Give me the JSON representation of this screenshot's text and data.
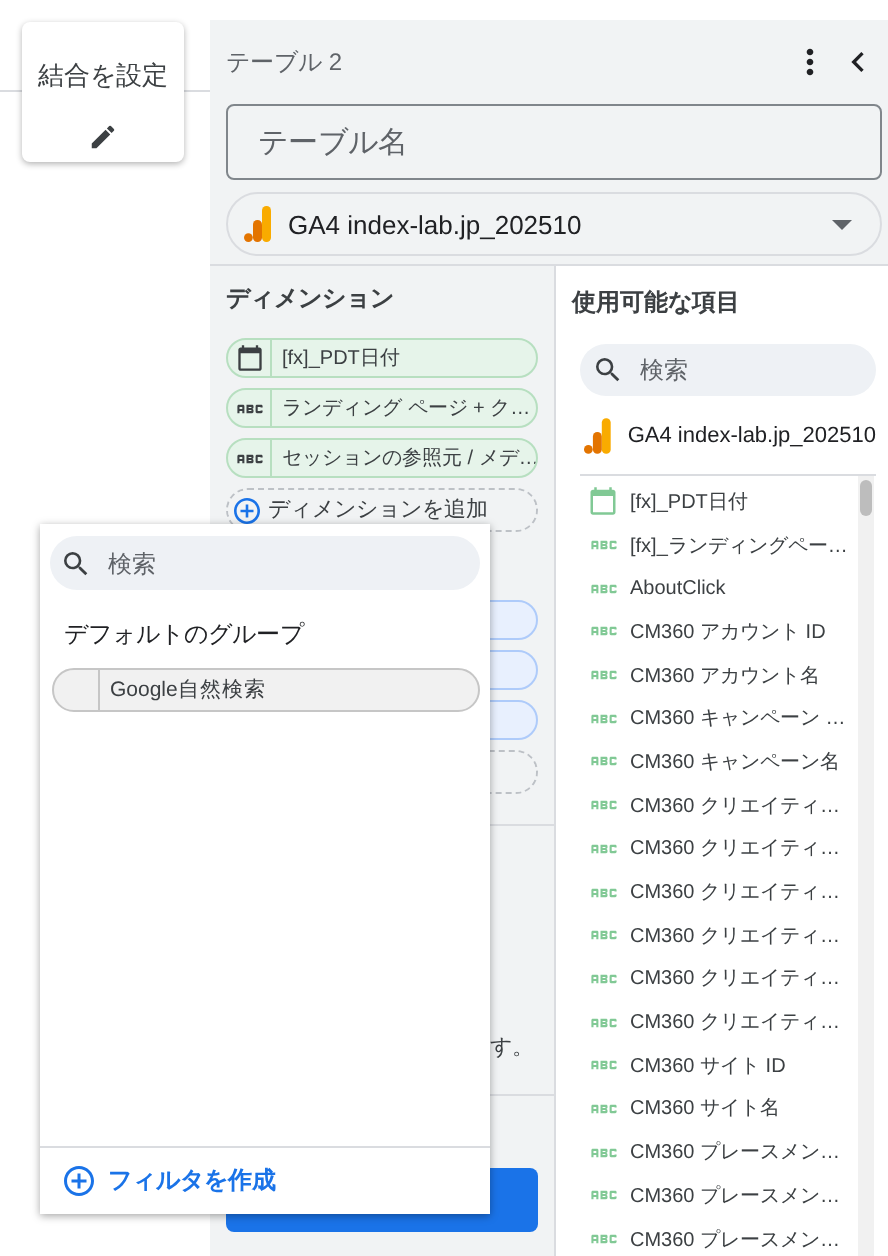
{
  "join_card": {
    "label": "結合を設定"
  },
  "panel": {
    "title": "テーブル 2",
    "name_field": {
      "placeholder": "テーブル名"
    },
    "source": "GA4 index-lab.jp_202510"
  },
  "dimensions": {
    "heading": "ディメンション",
    "items": [
      {
        "kind": "date",
        "label": "[fx]_PDT日付"
      },
      {
        "kind": "text",
        "label": "ランディング ページ + ク…"
      },
      {
        "kind": "text",
        "label": "セッションの参照元 / メデ…"
      }
    ],
    "add_label": "ディメンションを追加"
  },
  "note_fragment": "す。",
  "available": {
    "heading": "使用可能な項目",
    "search": {
      "placeholder": "検索"
    },
    "source": "GA4 index-lab.jp_202510",
    "fields": [
      {
        "kind": "date",
        "label": "[fx]_PDT日付"
      },
      {
        "kind": "text",
        "label": "[fx]_ランディングペー…"
      },
      {
        "kind": "text",
        "label": "AboutClick"
      },
      {
        "kind": "text",
        "label": "CM360 アカウント ID"
      },
      {
        "kind": "text",
        "label": "CM360 アカウント名"
      },
      {
        "kind": "text",
        "label": "CM360 キャンペーン …"
      },
      {
        "kind": "text",
        "label": "CM360 キャンペーン名"
      },
      {
        "kind": "text",
        "label": "CM360 クリエイティ…"
      },
      {
        "kind": "text",
        "label": "CM360 クリエイティ…"
      },
      {
        "kind": "text",
        "label": "CM360 クリエイティ…"
      },
      {
        "kind": "text",
        "label": "CM360 クリエイティ…"
      },
      {
        "kind": "text",
        "label": "CM360 クリエイティ…"
      },
      {
        "kind": "text",
        "label": "CM360 クリエイティ…"
      },
      {
        "kind": "text",
        "label": "CM360 サイト ID"
      },
      {
        "kind": "text",
        "label": "CM360 サイト名"
      },
      {
        "kind": "text",
        "label": "CM360 プレースメン…"
      },
      {
        "kind": "text",
        "label": "CM360 プレースメン…"
      },
      {
        "kind": "text",
        "label": "CM360 プレースメン…"
      }
    ]
  },
  "filter_popup": {
    "search": {
      "placeholder": "検索"
    },
    "group_heading": "デフォルトのグループ",
    "groups": [
      {
        "label": "Google自然検索"
      }
    ],
    "create_label": "フィルタを作成"
  }
}
